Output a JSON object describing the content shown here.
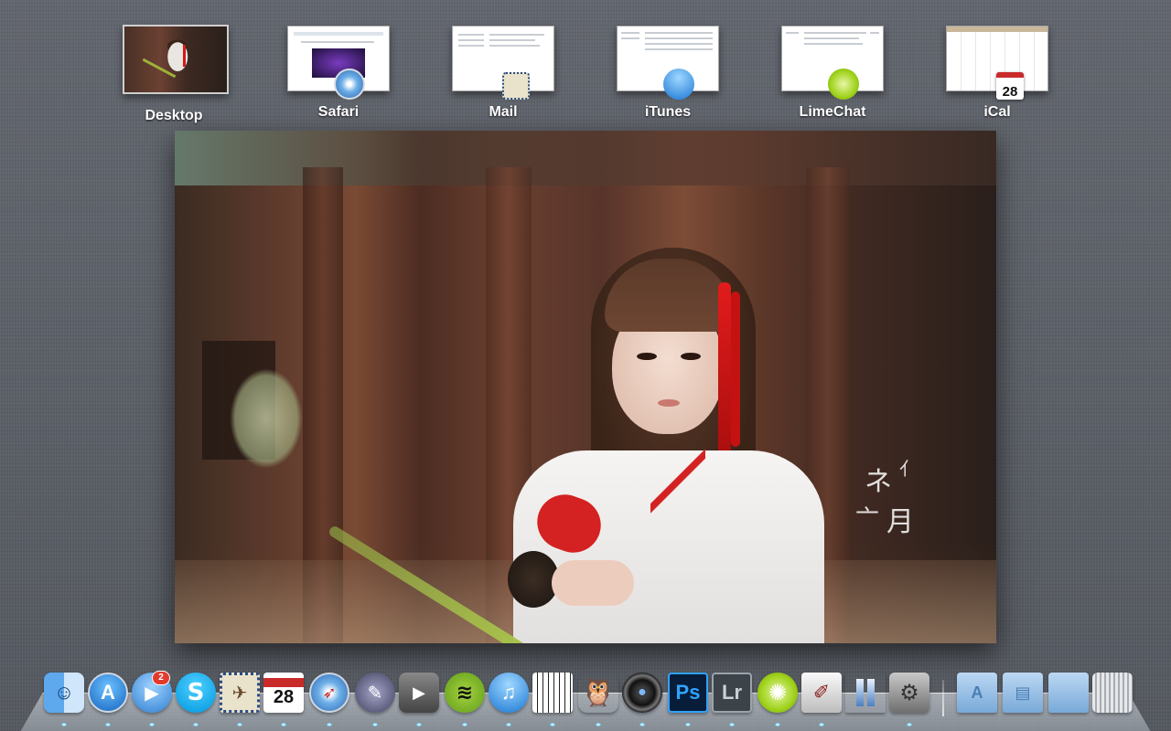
{
  "spaces": [
    {
      "label": "Desktop",
      "icon": "desktop-wallpaper-thumb"
    },
    {
      "label": "Safari",
      "icon": "safari-icon"
    },
    {
      "label": "Mail",
      "icon": "mail-icon"
    },
    {
      "label": "iTunes",
      "icon": "itunes-icon"
    },
    {
      "label": "LimeChat",
      "icon": "limechat-icon"
    },
    {
      "label": "iCal",
      "icon": "ical-icon",
      "date": "28"
    }
  ],
  "wallpaper": {
    "icon": "samurai-girl-wallpaper"
  },
  "dock": {
    "apps": [
      {
        "icon": "finder-icon"
      },
      {
        "icon": "app-store-icon"
      },
      {
        "icon": "facetime-icon",
        "badge": "2"
      },
      {
        "icon": "skype-icon"
      },
      {
        "icon": "mail-icon"
      },
      {
        "icon": "ical-icon",
        "date": "28"
      },
      {
        "icon": "safari-icon"
      },
      {
        "icon": "ilife-icon"
      },
      {
        "icon": "dvd-player-icon"
      },
      {
        "icon": "spotify-icon"
      },
      {
        "icon": "itunes-icon"
      },
      {
        "icon": "piano-icon"
      },
      {
        "icon": "owl-icon"
      },
      {
        "icon": "camera-lens-icon"
      },
      {
        "icon": "photoshop-icon",
        "text": "Ps"
      },
      {
        "icon": "lightroom-icon",
        "text": "Lr"
      },
      {
        "icon": "limechat-icon"
      },
      {
        "icon": "script-editor-icon"
      },
      {
        "icon": "columns-icon"
      },
      {
        "icon": "system-preferences-icon"
      }
    ],
    "stacks": [
      {
        "icon": "applications-folder-icon"
      },
      {
        "icon": "documents-folder-icon"
      },
      {
        "icon": "downloads-folder-icon"
      },
      {
        "icon": "trash-icon"
      }
    ]
  },
  "colors": {
    "background": "#5a5e66",
    "dock_indicator": "#6fd2ff"
  }
}
